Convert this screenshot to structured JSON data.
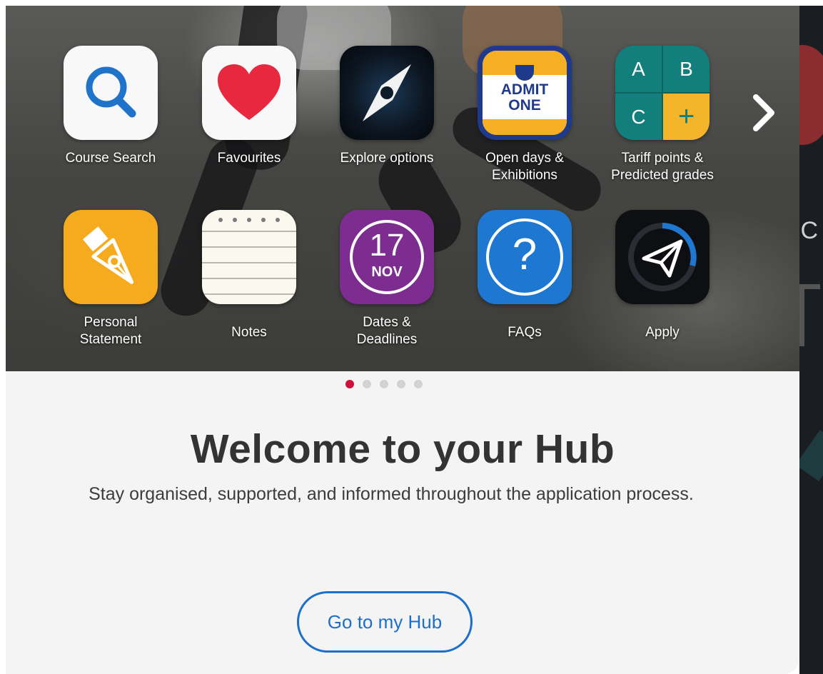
{
  "apps_row1": [
    {
      "label": "Course Search"
    },
    {
      "label": "Favourites"
    },
    {
      "label": "Explore options"
    },
    {
      "label": "Open days &\nExhibitions",
      "ticket_text": "ADMIT\nONE"
    },
    {
      "label": "Tariff points &\nPredicted grades",
      "grid_letters": [
        "A",
        "B",
        "C",
        "+"
      ]
    }
  ],
  "apps_row2": [
    {
      "label": "Personal\nStatement"
    },
    {
      "label": "Notes"
    },
    {
      "label": "Dates &\nDeadlines",
      "day": "17",
      "month": "NOV"
    },
    {
      "label": "FAQs",
      "glyph": "?"
    },
    {
      "label": "Apply"
    }
  ],
  "carousel": {
    "pages": 5,
    "active_page": 1
  },
  "welcome": {
    "title": "Welcome to your Hub",
    "subtitle": "Stay organised, supported, and informed throughout the application process."
  },
  "cta": {
    "label": "Go to my Hub"
  },
  "colors": {
    "accent_blue": "#1d6fc9",
    "dot_active": "#d0103a",
    "heart_red": "#e8283f",
    "calendar_purple": "#7d2c8f",
    "faq_blue": "#1e78d2",
    "tariff_teal": "#127f7c",
    "tariff_yellow": "#f4b52a",
    "statement_yellow": "#f6ab1f"
  },
  "icons": {
    "course_search": "search-icon",
    "favourites": "heart-icon",
    "explore": "compass-icon",
    "open_days": "ticket-icon",
    "tariff": "grade-grid-icon",
    "statement": "pen-nib-icon",
    "notes": "notepad-icon",
    "dates": "calendar-icon",
    "faqs": "question-icon",
    "apply": "paper-plane-icon",
    "next": "chevron-right-icon"
  }
}
